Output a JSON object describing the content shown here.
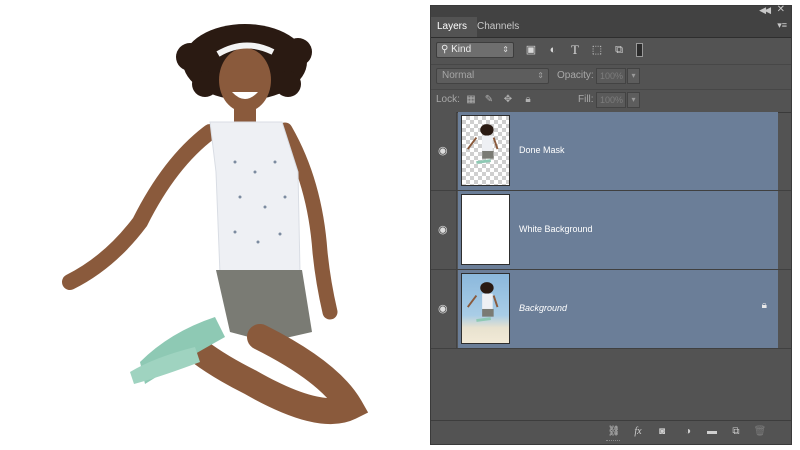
{
  "panel": {
    "tabs": [
      {
        "label": "Layers"
      },
      {
        "label": "Channels"
      }
    ],
    "filter": {
      "kind_label": "Kind",
      "icons": [
        "pixel-filter-icon",
        "adjustment-filter-icon",
        "type-filter-icon",
        "shape-filter-icon",
        "smart-object-filter-icon"
      ]
    },
    "blend": {
      "mode": "Normal",
      "opacity_label": "Opacity:",
      "opacity_value": "100%",
      "fill_label": "Fill:",
      "fill_value": "100%",
      "lock_label": "Lock:"
    },
    "layers": [
      {
        "name": "Done Mask",
        "thumb": "checker",
        "selected": true,
        "italic": false,
        "locked": false
      },
      {
        "name": "White Background",
        "thumb": "white",
        "selected": true,
        "italic": false,
        "locked": false
      },
      {
        "name": "Background",
        "thumb": "photo",
        "selected": true,
        "italic": true,
        "locked": true
      }
    ],
    "bottom_icons": [
      "link-layers-icon",
      "fx-icon",
      "add-mask-icon",
      "adjustment-layer-icon",
      "new-group-icon",
      "new-layer-icon",
      "delete-icon"
    ]
  },
  "colors": {
    "panel_bg": "#535353",
    "selection": "#6b7e98"
  }
}
